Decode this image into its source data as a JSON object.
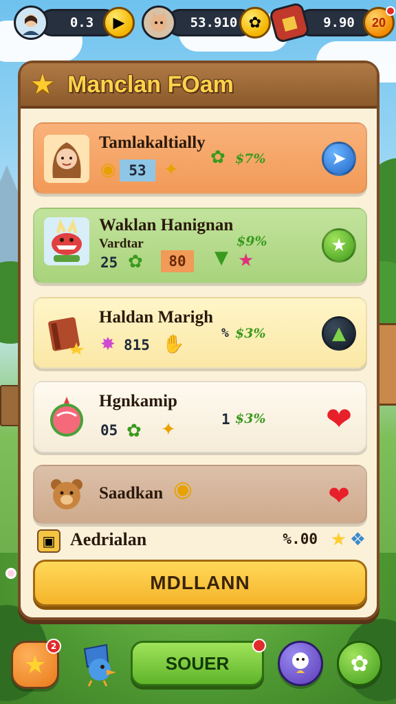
{
  "hud": {
    "player1_value": "0.3",
    "player2_value": "53.910",
    "player3_value": "9.90",
    "player3_level": "20"
  },
  "panel": {
    "title": "Manclan FOam"
  },
  "rows": [
    {
      "name": "Tamlakaltially",
      "stat_value": "53",
      "percent": "$7%",
      "color": "#f5a463"
    },
    {
      "name": "Waklan Hanignan",
      "subtitle": "Vardtar",
      "stat_value": "25",
      "stat_value_2": "80",
      "percent": "$9%",
      "color": "#b7dc8f"
    },
    {
      "name": "Haldan Marigh",
      "stat_value": "815",
      "percent_prefix": "%",
      "percent": "$3%",
      "color": "#fff0b8"
    },
    {
      "name": "Hgnkamip",
      "stat_value": "05",
      "percent_prefix": "1",
      "percent": "$3%",
      "color": "#fcf3e4"
    },
    {
      "name": "Saadkan",
      "color": "#d8b8a0"
    }
  ],
  "footer": {
    "label": "Aedrialan",
    "value": "%.00"
  },
  "main_button_label": "MDLLANN",
  "bottom_nav": {
    "main_label": "SOUER",
    "star_badge": "2"
  }
}
